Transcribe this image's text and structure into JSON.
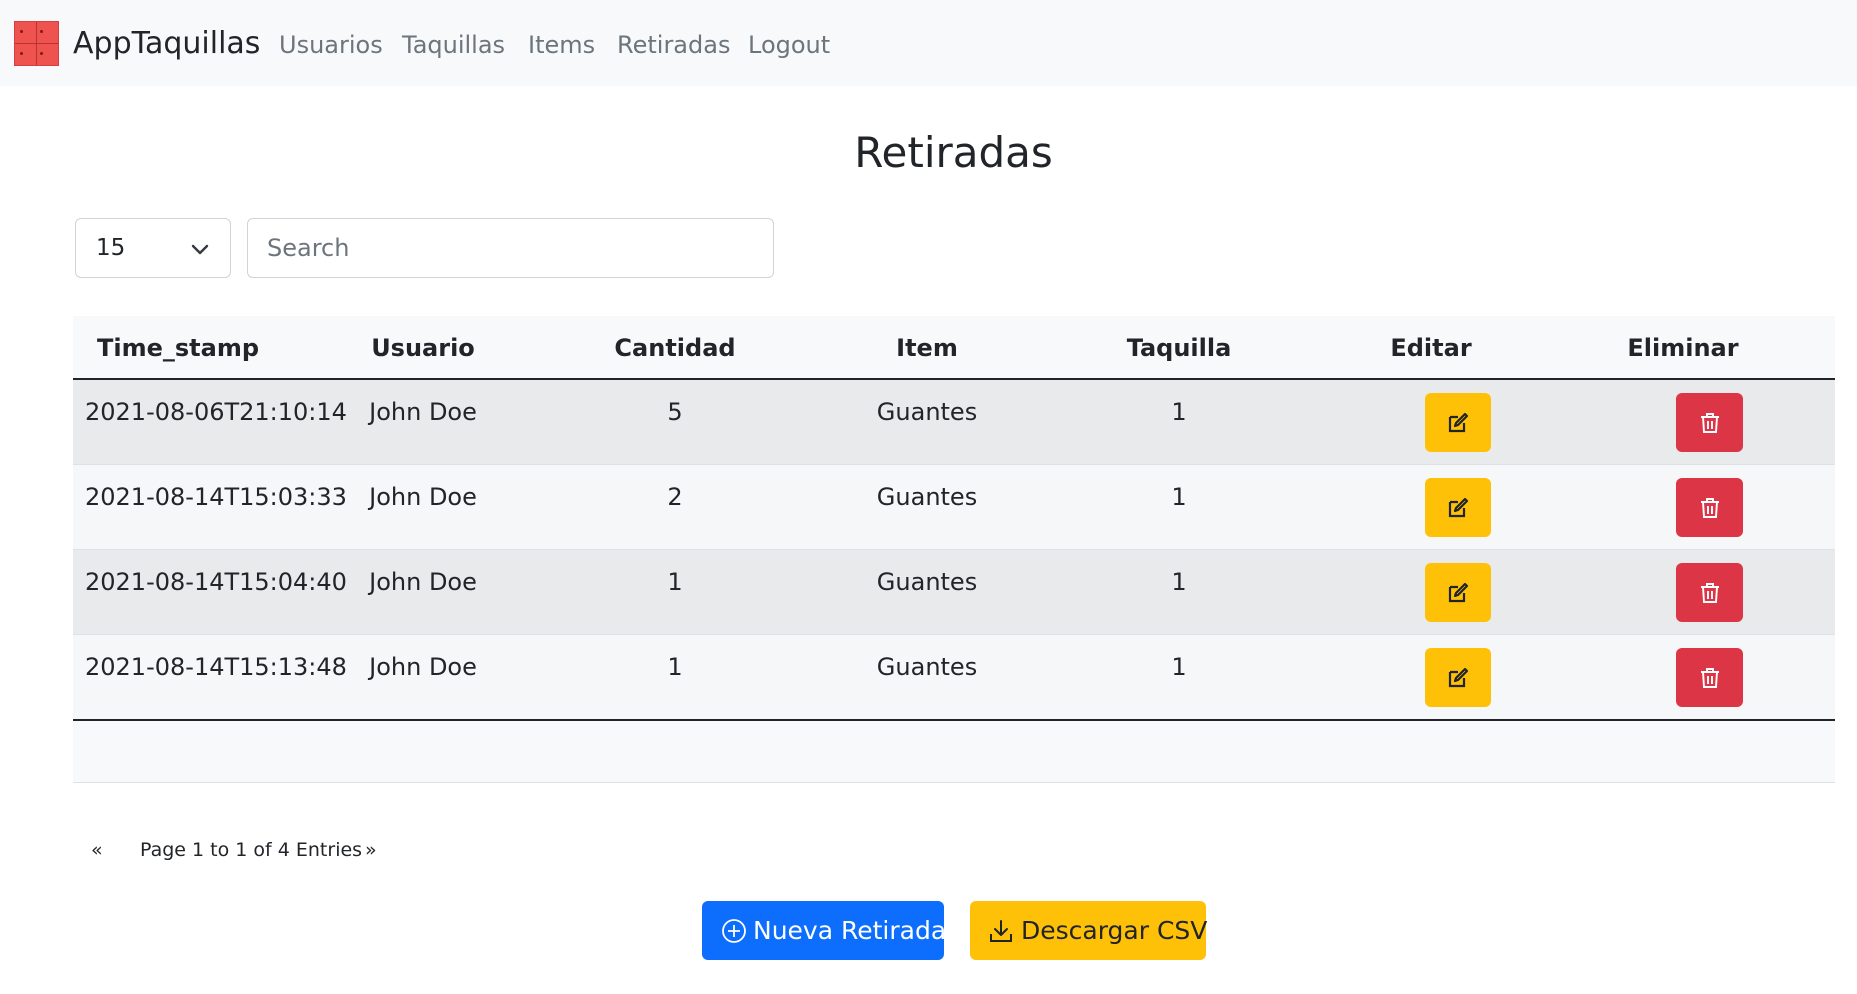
{
  "nav": {
    "brand": "AppTaquillas",
    "logo_icon": "locker-icon",
    "links": [
      "Usuarios",
      "Taquillas",
      "Items",
      "Retiradas",
      "Logout"
    ]
  },
  "page": {
    "title": "Retiradas"
  },
  "controls": {
    "page_size": "15",
    "search_placeholder": "Search"
  },
  "table": {
    "headers": [
      "Time_stamp",
      "Usuario",
      "Cantidad",
      "Item",
      "Taquilla",
      "Editar",
      "Eliminar"
    ],
    "rows": [
      {
        "time_stamp": "2021-08-06T21:10:14",
        "usuario": "John Doe",
        "cantidad": "5",
        "item": "Guantes",
        "taquilla": "1"
      },
      {
        "time_stamp": "2021-08-14T15:03:33",
        "usuario": "John Doe",
        "cantidad": "2",
        "item": "Guantes",
        "taquilla": "1"
      },
      {
        "time_stamp": "2021-08-14T15:04:40",
        "usuario": "John Doe",
        "cantidad": "1",
        "item": "Guantes",
        "taquilla": "1"
      },
      {
        "time_stamp": "2021-08-14T15:13:48",
        "usuario": "John Doe",
        "cantidad": "1",
        "item": "Guantes",
        "taquilla": "1"
      }
    ]
  },
  "pagination": {
    "prev": "«",
    "info": "Page 1 to 1 of 4 Entries",
    "next": "»"
  },
  "actions": {
    "new_label": "Nueva Retirada",
    "csv_label": "Descargar CSV"
  },
  "colors": {
    "edit": "#ffc107",
    "delete": "#dc3545",
    "primary": "#0d6efd",
    "logo": "#ef5350"
  }
}
